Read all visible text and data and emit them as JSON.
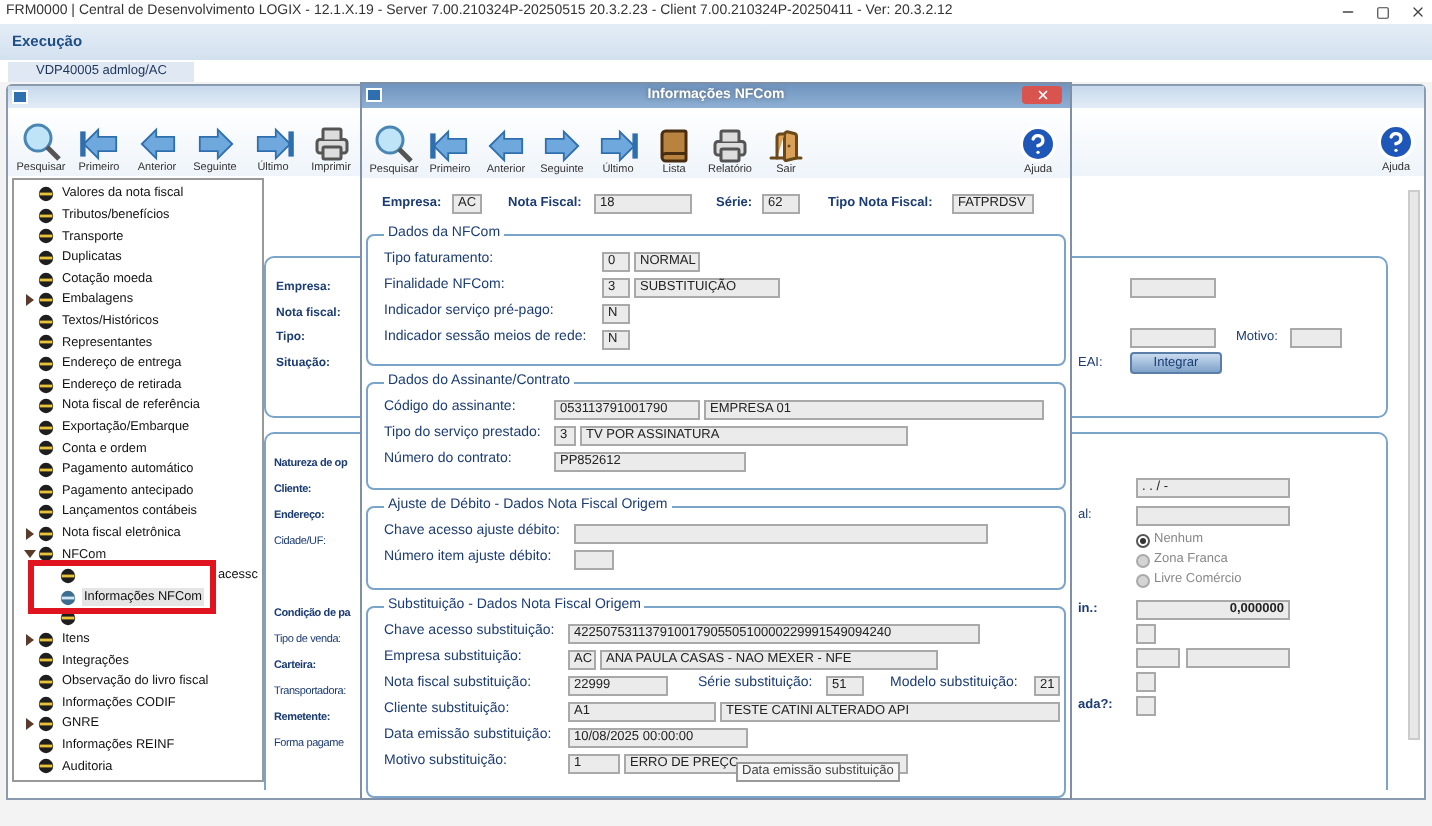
{
  "title_bar": {
    "title": "FRM0000 | Central de Desenvolvimento LOGIX  -  12.1.X.19 - Server 7.00.210324P-20250515 20.3.2.23 - Client 7.00.210324P-20250411 - Ver: 20.3.2.12"
  },
  "menu": [
    "Execução"
  ],
  "tabs": [
    {
      "label": "VDP40005 admlog/AC",
      "selected": true
    }
  ],
  "main_window": {
    "toolbar": [
      {
        "kind": "search",
        "label": "Pesquisar"
      },
      {
        "kind": "first",
        "label": "Primeiro"
      },
      {
        "kind": "previous",
        "label": "Anterior"
      },
      {
        "kind": "next",
        "label": "Seguinte"
      },
      {
        "kind": "last",
        "label": "Último"
      },
      {
        "kind": "print",
        "label": "Imprimir"
      }
    ],
    "help": {
      "label": "Ajuda"
    },
    "tree": [
      {
        "label": "Valores da nota fiscal",
        "selected": false
      },
      {
        "label": "Tributos/benefícios",
        "selected": false
      },
      {
        "label": "Transporte",
        "selected": false
      },
      {
        "label": "Duplicatas",
        "selected": false
      },
      {
        "label": "Cotação moeda",
        "selected": false
      },
      {
        "label": "Embalagens",
        "selected": false,
        "expanded": false
      },
      {
        "label": "Textos/Históricos",
        "selected": false
      },
      {
        "label": "Representantes",
        "selected": false
      },
      {
        "label": "Endereço de entrega",
        "selected": false
      },
      {
        "label": "Endereço de retirada",
        "selected": false
      },
      {
        "label": "Nota fiscal de referência",
        "selected": false
      },
      {
        "label": "Exportação/Embarque",
        "selected": false
      },
      {
        "label": "Conta e ordem",
        "selected": false
      },
      {
        "label": "Pagamento automático",
        "selected": false
      },
      {
        "label": "Pagamento antecipado",
        "selected": false
      },
      {
        "label": "Lançamentos contábeis",
        "selected": false
      },
      {
        "label": "Nota fiscal eletrônica",
        "selected": false,
        "expanded": false
      },
      {
        "label": "NFCom",
        "selected": false,
        "expanded": true,
        "children": [
          {
            "kind": "partly_covered",
            "label": "acessc",
            "selected": false
          },
          {
            "kind": "item",
            "label": "Informações NFCom",
            "selected": true
          },
          {
            "kind": "covered",
            "selected": false
          }
        ]
      },
      {
        "label": "Itens",
        "selected": false,
        "expanded": false
      },
      {
        "label": "Integrações",
        "selected": false
      },
      {
        "label": "Observação do livro fiscal",
        "selected": false
      },
      {
        "label": "Informações CODIF",
        "selected": false
      },
      {
        "label": "GNRE",
        "selected": false,
        "expanded": false
      },
      {
        "label": "Informações REINF",
        "selected": false
      },
      {
        "label": "Auditoria",
        "selected": false
      }
    ],
    "form": {
      "panel_1": {
        "labels": [
          "Empresa:",
          "Nota fiscal:",
          "Tipo:",
          "Situação:"
        ],
        "motivo_label": "Motivo:",
        "eai_label": "EAI:",
        "integrar_button": "Integrar"
      },
      "panel_2": {
        "labels": [
          "Natureza de op",
          "Cliente:",
          "Endereço:",
          "Cidade/UF:",
          "Condição de pa",
          "Tipo de venda:",
          "Carteira:",
          "Transportadora:",
          "Remetente:",
          "Forma pagame"
        ],
        "cnpj_mask": ". . / -",
        "al_label": "al:",
        "radios": [
          {
            "label": "Nenhum",
            "selected": true
          },
          {
            "label": "Zona Franca",
            "selected": false
          },
          {
            "label": "Livre Comércio",
            "selected": false
          }
        ],
        "in_label": "in.:",
        "amount": "0,000000",
        "ada_label": "ada?:"
      }
    }
  },
  "dialog": {
    "title": "Informações NFCom",
    "toolbar": [
      {
        "kind": "search",
        "label": "Pesquisar"
      },
      {
        "kind": "first",
        "label": "Primeiro"
      },
      {
        "kind": "previous",
        "label": "Anterior"
      },
      {
        "kind": "next",
        "label": "Seguinte"
      },
      {
        "kind": "last",
        "label": "Último"
      },
      {
        "kind": "list",
        "label": "Lista"
      },
      {
        "kind": "report",
        "label": "Relatório"
      },
      {
        "kind": "exit",
        "label": "Sair"
      }
    ],
    "help": {
      "label": "Ajuda"
    },
    "header": [
      {
        "kind": "label",
        "text": "Empresa:"
      },
      {
        "kind": "field",
        "value": "AC"
      },
      {
        "kind": "label",
        "text": "Nota Fiscal:"
      },
      {
        "kind": "field",
        "value": "18"
      },
      {
        "kind": "label",
        "text": "Série:"
      },
      {
        "kind": "field",
        "value": "62"
      },
      {
        "kind": "label",
        "text": "Tipo Nota Fiscal:"
      },
      {
        "kind": "field",
        "value": "FATPRDSV"
      }
    ],
    "groups": [
      {
        "title": "Dados da NFCom",
        "rows": [
          {
            "label": "Tipo faturamento:",
            "parts": [
              {
                "kind": "field",
                "value": "0"
              },
              {
                "kind": "field",
                "value": "NORMAL"
              }
            ]
          },
          {
            "label": "Finalidade NFCom:",
            "parts": [
              {
                "kind": "field",
                "value": "3"
              },
              {
                "kind": "field",
                "value": "SUBSTITUIÇÃO"
              }
            ]
          },
          {
            "label": "Indicador serviço pré-pago:",
            "parts": [
              {
                "kind": "field",
                "value": "N"
              }
            ]
          },
          {
            "label": "Indicador sessão meios de rede:",
            "parts": [
              {
                "kind": "field",
                "value": "N"
              }
            ]
          }
        ]
      },
      {
        "title": "Dados do Assinante/Contrato",
        "rows": [
          {
            "label": "Código do assinante:",
            "parts": [
              {
                "kind": "field",
                "value": "053113791001790"
              },
              {
                "kind": "field",
                "value": "EMPRESA 01"
              }
            ]
          },
          {
            "label": "Tipo do serviço prestado:",
            "parts": [
              {
                "kind": "field",
                "value": "3"
              },
              {
                "kind": "field",
                "value": "TV POR ASSINATURA"
              }
            ]
          },
          {
            "label": "Número do contrato:",
            "parts": [
              {
                "kind": "field",
                "value": "PP852612"
              }
            ]
          }
        ]
      },
      {
        "title": "Ajuste de Débito - Dados Nota Fiscal Origem",
        "rows": [
          {
            "label": "Chave acesso ajuste débito:",
            "parts": [
              {
                "kind": "field"
              }
            ]
          },
          {
            "label": "Número item ajuste débito:",
            "parts": [
              {
                "kind": "field"
              }
            ]
          }
        ]
      },
      {
        "title": "Substituição - Dados Nota Fiscal Origem",
        "rows": [
          {
            "label": "Chave acesso substituição:",
            "parts": [
              {
                "kind": "field",
                "value": "42250753113791001790550510000229991549094240"
              }
            ]
          },
          {
            "label": "Empresa substituição:",
            "parts": [
              {
                "kind": "field",
                "value": "AC"
              },
              {
                "kind": "field",
                "value": "ANA PAULA CASAS - NAO MEXER - NFE"
              }
            ]
          },
          {
            "label": "Nota fiscal substituição:",
            "parts": [
              {
                "kind": "field",
                "value": "22999"
              },
              {
                "kind": "label",
                "text": "Série substituição:"
              },
              {
                "kind": "field",
                "value": "51"
              },
              {
                "kind": "label",
                "text": "Modelo substituição:"
              },
              {
                "kind": "field",
                "value": "21"
              }
            ]
          },
          {
            "label": "Cliente substituição:",
            "parts": [
              {
                "kind": "field",
                "value": "A1"
              },
              {
                "kind": "field",
                "value": "TESTE CATINI ALTERADO API"
              }
            ]
          },
          {
            "label": "Data emissão substituição:",
            "parts": [
              {
                "kind": "field",
                "value": "10/08/2025 00:00:00"
              }
            ]
          },
          {
            "label": "Motivo substituição:",
            "parts": [
              {
                "kind": "field",
                "value": "1"
              },
              {
                "kind": "field",
                "value": "ERRO DE PREÇC"
              }
            ]
          }
        ]
      }
    ],
    "tooltip": "Data emissão substituição"
  }
}
